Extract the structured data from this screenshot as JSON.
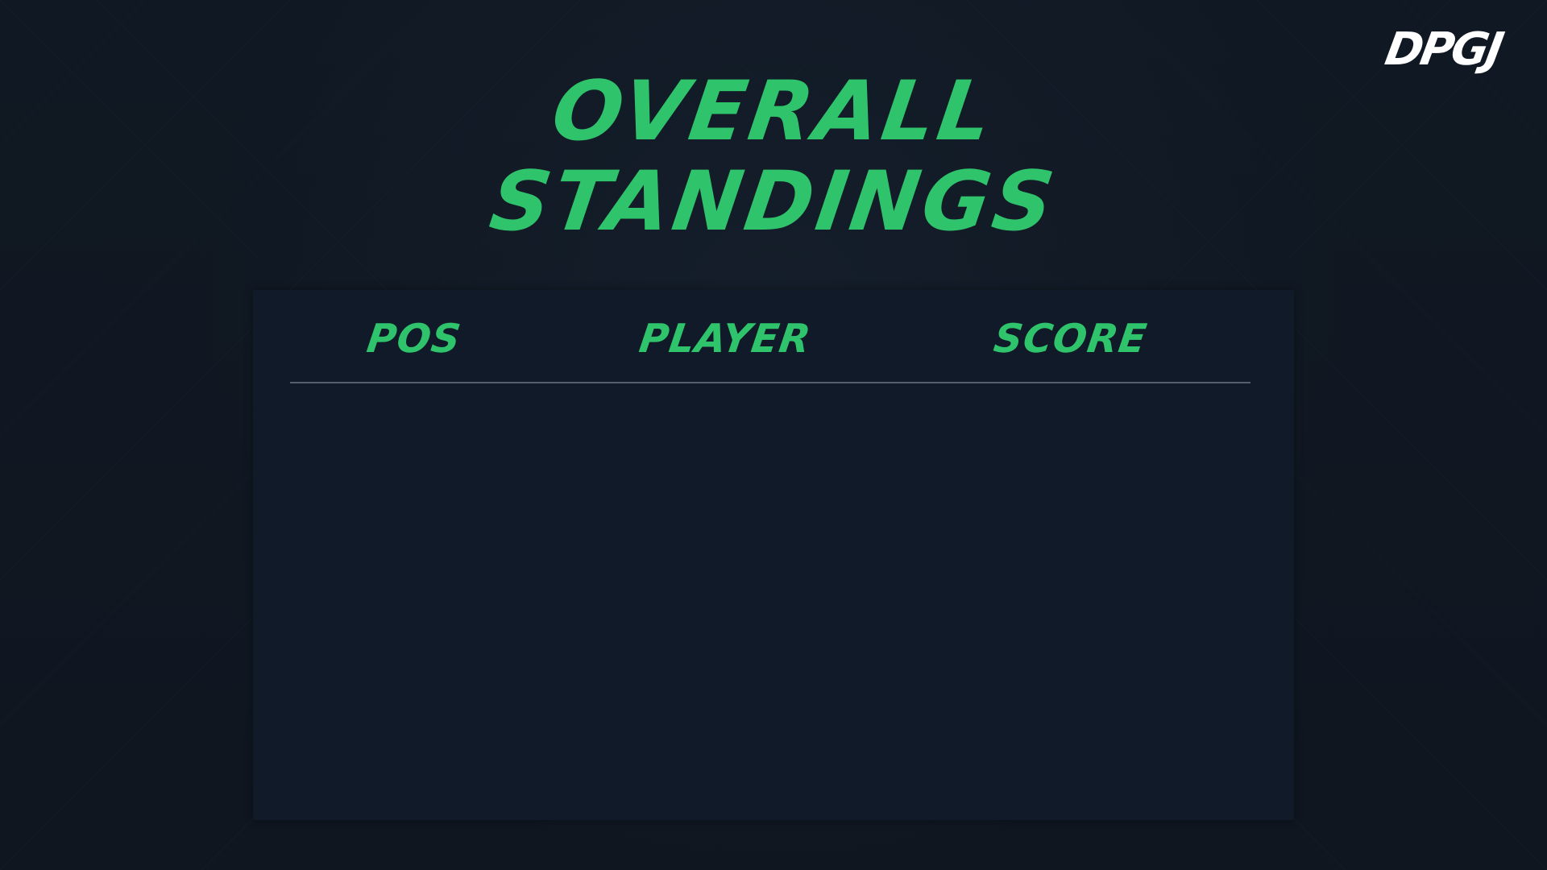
{
  "brand": {
    "logo_text": "DPGJ"
  },
  "title": {
    "line1": "OVERALL",
    "line2": "STANDINGS"
  },
  "table": {
    "headers": {
      "pos": "POS",
      "player": "PLAYER",
      "score": "SCORE"
    },
    "rows": []
  },
  "colors": {
    "background": "#0f1721",
    "accent": "#2fc46b",
    "panel": "#101a29",
    "divider": "#56606a",
    "logo": "#ffffff"
  }
}
